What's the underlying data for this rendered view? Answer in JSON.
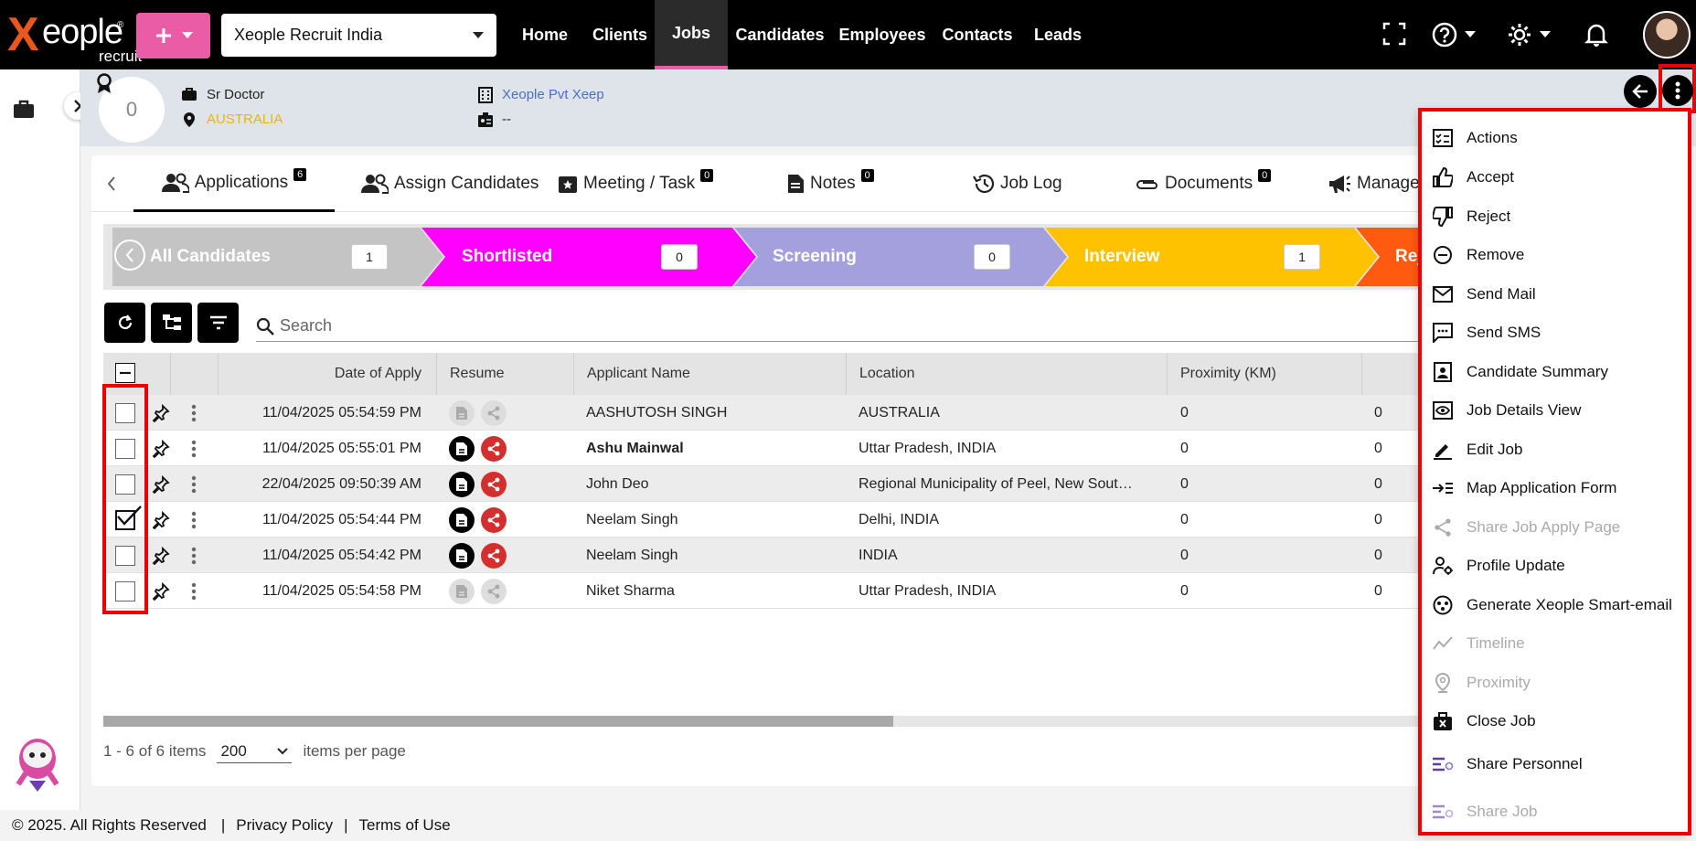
{
  "topbar": {
    "logo_main": "eople",
    "logo_x": "X",
    "logo_sub": "recruit",
    "logo_reg": "®",
    "org_select": "Xeople Recruit India",
    "nav": [
      "Home",
      "Clients",
      "Jobs",
      "Candidates",
      "Employees",
      "Contacts",
      "Leads"
    ]
  },
  "job": {
    "title": "Sr Doctor",
    "location": "AUSTRALIA",
    "company": "Xeople Pvt Xeep",
    "id": "--",
    "circle_value": "0"
  },
  "tabs": [
    {
      "label": "Applications",
      "badge": "6"
    },
    {
      "label": "Assign Candidates",
      "badge": ""
    },
    {
      "label": "Meeting / Task",
      "badge": "0"
    },
    {
      "label": "Notes",
      "badge": "0"
    },
    {
      "label": "Job Log",
      "badge": ""
    },
    {
      "label": "Documents",
      "badge": "0"
    },
    {
      "label": "Manage",
      "badge": ""
    }
  ],
  "pipeline": [
    {
      "label": "All Candidates",
      "count": "1",
      "color": "#c4c4c4"
    },
    {
      "label": "Shortlisted",
      "count": "0",
      "color": "#ff00ff"
    },
    {
      "label": "Screening",
      "count": "0",
      "color": "#a3a0dd"
    },
    {
      "label": "Interview",
      "count": "1",
      "color": "#ffc200"
    },
    {
      "label": "Rej",
      "count": "",
      "color": "#ff5a10"
    }
  ],
  "search": {
    "placeholder": "Search"
  },
  "table": {
    "columns": [
      "Date of Apply",
      "Resume",
      "Applicant Name",
      "Location",
      "Proximity (KM)"
    ],
    "rows": [
      {
        "date": "11/04/2025 05:54:59 PM",
        "name": "AASHUTOSH SINGH",
        "location": "AUSTRALIA",
        "proximity": "0",
        "extra": "0",
        "checked": false,
        "resume": false,
        "bold": false
      },
      {
        "date": "11/04/2025 05:55:01 PM",
        "name": "Ashu Mainwal",
        "location": "Uttar Pradesh, INDIA",
        "proximity": "0",
        "extra": "0",
        "checked": false,
        "resume": true,
        "bold": true
      },
      {
        "date": "22/04/2025 09:50:39 AM",
        "name": "John Deo",
        "location": "Regional Municipality of Peel, New Sout…",
        "proximity": "0",
        "extra": "0",
        "checked": false,
        "resume": true,
        "bold": false
      },
      {
        "date": "11/04/2025 05:54:44 PM",
        "name": "Neelam Singh",
        "location": "Delhi, INDIA",
        "proximity": "0",
        "extra": "0",
        "checked": true,
        "resume": true,
        "bold": false
      },
      {
        "date": "11/04/2025 05:54:42 PM",
        "name": "Neelam Singh",
        "location": "INDIA",
        "proximity": "0",
        "extra": "0",
        "checked": false,
        "resume": true,
        "bold": false
      },
      {
        "date": "11/04/2025 05:54:58 PM",
        "name": "Niket Sharma",
        "location": "Uttar Pradesh, INDIA",
        "proximity": "0",
        "extra": "0",
        "checked": false,
        "resume": false,
        "bold": false
      }
    ]
  },
  "pager": {
    "range": "1 - 6 of 6 items",
    "page_size": "200",
    "suffix": "items per page"
  },
  "footer": {
    "copyright": "© 2025. All Rights Reserved",
    "sep": "|",
    "privacy": "Privacy Policy",
    "terms": "Terms of Use"
  },
  "menu": [
    {
      "label": "Actions",
      "icon": "actions-icon",
      "disabled": false
    },
    {
      "label": "Accept",
      "icon": "thumbs-up-icon",
      "disabled": false
    },
    {
      "label": "Reject",
      "icon": "thumbs-down-icon",
      "disabled": false
    },
    {
      "label": "Remove",
      "icon": "remove-circle-icon",
      "disabled": false
    },
    {
      "label": "Send Mail",
      "icon": "mail-icon",
      "disabled": false
    },
    {
      "label": "Send SMS",
      "icon": "sms-icon",
      "disabled": false
    },
    {
      "label": "Candidate Summary",
      "icon": "summary-icon",
      "disabled": false
    },
    {
      "label": "Job Details View",
      "icon": "eye-icon",
      "disabled": false
    },
    {
      "label": "Edit Job",
      "icon": "edit-icon",
      "disabled": false
    },
    {
      "label": "Map Application Form",
      "icon": "map-form-icon",
      "disabled": false
    },
    {
      "label": "Share Job Apply Page",
      "icon": "share-icon",
      "disabled": true
    },
    {
      "label": "Profile Update",
      "icon": "profile-update-icon",
      "disabled": false
    },
    {
      "label": "Generate Xeople Smart-email",
      "icon": "smart-email-icon",
      "disabled": false
    },
    {
      "label": "Timeline",
      "icon": "timeline-icon",
      "disabled": true
    },
    {
      "label": "Proximity",
      "icon": "location-pin-icon",
      "disabled": true
    },
    {
      "label": "Close Job",
      "icon": "close-job-icon",
      "disabled": false
    },
    {
      "label": "Share Personnel",
      "icon": "share-personnel-icon",
      "disabled": false
    },
    {
      "label": "Share Job",
      "icon": "share-job-icon",
      "disabled": true
    }
  ],
  "colors": {
    "accent": "#ea5ca5",
    "highlight": "#ee0000",
    "share": "#d32f2f"
  }
}
